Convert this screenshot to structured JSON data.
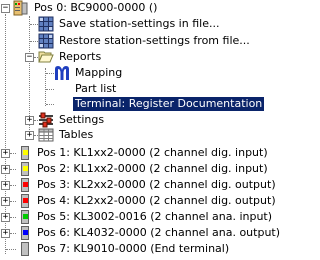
{
  "tree": {
    "root": {
      "label": "Pos 0: BC9000-0000  ()"
    },
    "save_item": {
      "label": "Save station-settings in file..."
    },
    "restore_item": {
      "label": "Restore station-settings from file..."
    },
    "reports": {
      "label": "Reports",
      "children": [
        {
          "label": "Mapping"
        },
        {
          "label": "Part list"
        },
        {
          "label": "Terminal: Register Documentation",
          "selected": true
        }
      ]
    },
    "settings": {
      "label": "Settings"
    },
    "tables": {
      "label": "Tables"
    },
    "positions": [
      {
        "label": "Pos 1: KL1xx2-0000  (2 channel dig. input)",
        "led_color": "#ffff00"
      },
      {
        "label": "Pos 2: KL1xx2-0000  (2 channel dig. input)",
        "led_color": "#ffff00"
      },
      {
        "label": "Pos 3: KL2xx2-0000  (2 channel dig. output)",
        "led_color": "#ff0000"
      },
      {
        "label": "Pos 4: KL2xx2-0000  (2 channel dig. output)",
        "led_color": "#ff0000"
      },
      {
        "label": "Pos 5: KL3002-0016  (2 channel ana. input)",
        "led_color": "#00cc00"
      },
      {
        "label": "Pos 6: KL4032-0000  (2 channel ana. output)",
        "led_color": "#0000ff"
      },
      {
        "label": "Pos 7: KL9010-0000  (End terminal)",
        "led_color": "#c0c0c0"
      }
    ]
  },
  "colors": {
    "selection": "#0a246a",
    "mapping_icon": "#1f3fbf"
  }
}
